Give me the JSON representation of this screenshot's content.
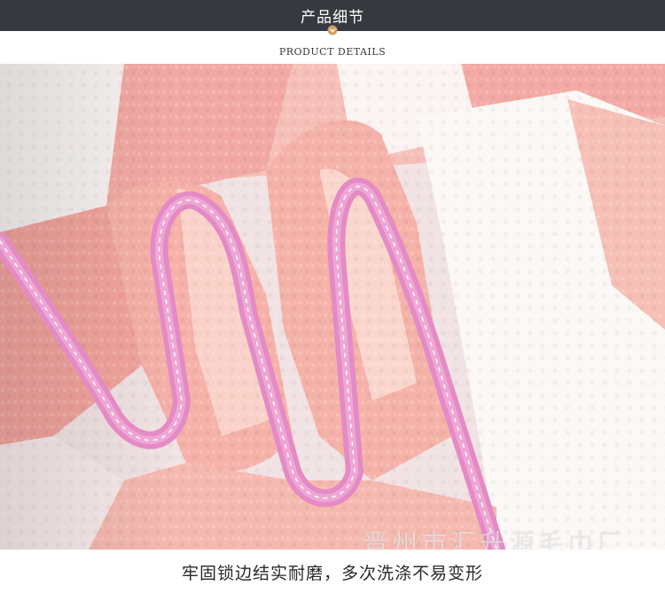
{
  "header": {
    "title": "产品细节",
    "subtitle": "PRODUCT DETAILS",
    "background": "#363a40",
    "pointer_color": "#c9a15d"
  },
  "image": {
    "subject": "pink-and-white-striped-coral-fleece-towel-with-pink-bound-edge",
    "watermark": "晋州市汇升源毛巾厂",
    "colors": {
      "pink_stripe": "#f3a9a3",
      "white_stripe": "#faf7f5",
      "edge_binding": "#e58fc6"
    }
  },
  "caption": {
    "text": "牢固锁边结实耐磨，多次洗涤不易变形"
  }
}
